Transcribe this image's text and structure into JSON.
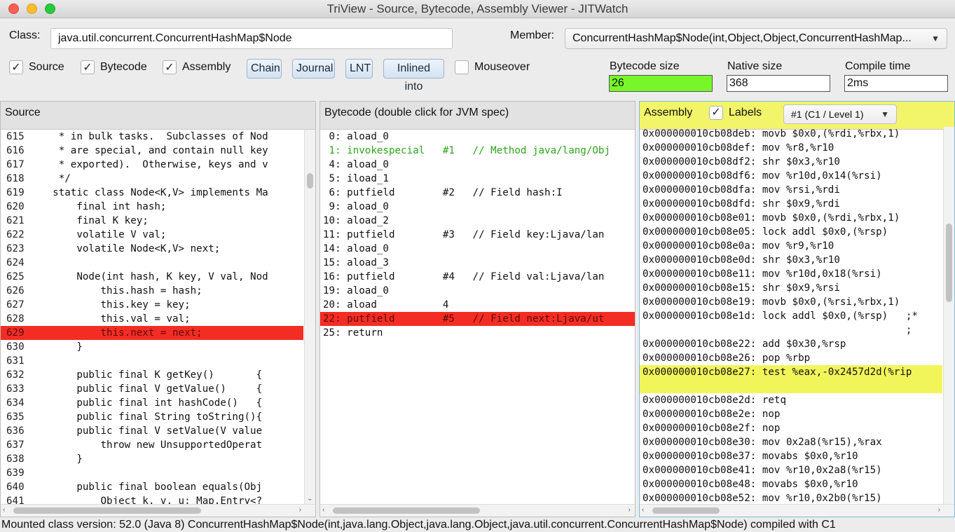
{
  "window": {
    "title": "TriView - Source, Bytecode, Assembly Viewer - JITWatch"
  },
  "toolbar": {
    "class_label": "Class:",
    "class_value": "java.util.concurrent.ConcurrentHashMap$Node",
    "member_label": "Member:",
    "member_value": "ConcurrentHashMap$Node(int,Object,Object,ConcurrentHashMap...",
    "checkboxes": {
      "source": "Source",
      "bytecode": "Bytecode",
      "assembly": "Assembly",
      "mouseover": "Mouseover"
    },
    "buttons": {
      "chain": "Chain",
      "journal": "Journal",
      "lnt": "LNT",
      "inlined": "Inlined into"
    },
    "metrics": {
      "bytecode_size_label": "Bytecode size",
      "bytecode_size": "26",
      "native_size_label": "Native size",
      "native_size": "368",
      "compile_time_label": "Compile time",
      "compile_time": "2ms"
    },
    "colors": {
      "bytecode_size_bg": "#77f72a"
    }
  },
  "source": {
    "header": "Source",
    "lines": [
      {
        "n": "615",
        "t": "     * in bulk tasks.  Subclasses of Nod"
      },
      {
        "n": "616",
        "t": "     * are special, and contain null key"
      },
      {
        "n": "617",
        "t": "     * exported).  Otherwise, keys and v"
      },
      {
        "n": "618",
        "t": "     */"
      },
      {
        "n": "619",
        "t": "    static class Node<K,V> implements Ma"
      },
      {
        "n": "620",
        "t": "        final int hash;"
      },
      {
        "n": "621",
        "t": "        final K key;"
      },
      {
        "n": "622",
        "t": "        volatile V val;"
      },
      {
        "n": "623",
        "t": "        volatile Node<K,V> next;"
      },
      {
        "n": "624",
        "t": ""
      },
      {
        "n": "625",
        "t": "        Node(int hash, K key, V val, Nod"
      },
      {
        "n": "626",
        "t": "            this.hash = hash;"
      },
      {
        "n": "627",
        "t": "            this.key = key;"
      },
      {
        "n": "628",
        "t": "            this.val = val;"
      },
      {
        "n": "629",
        "t": "            this.next = next;",
        "hl": "red"
      },
      {
        "n": "630",
        "t": "        }"
      },
      {
        "n": "631",
        "t": ""
      },
      {
        "n": "632",
        "t": "        public final K getKey()       {"
      },
      {
        "n": "633",
        "t": "        public final V getValue()     {"
      },
      {
        "n": "634",
        "t": "        public final int hashCode()   {"
      },
      {
        "n": "635",
        "t": "        public final String toString(){"
      },
      {
        "n": "636",
        "t": "        public final V setValue(V value"
      },
      {
        "n": "637",
        "t": "            throw new UnsupportedOperat"
      },
      {
        "n": "638",
        "t": "        }"
      },
      {
        "n": "639",
        "t": ""
      },
      {
        "n": "640",
        "t": "        public final boolean equals(Obj"
      },
      {
        "n": "641",
        "t": "            Object k, v, u; Map.Entry<?"
      }
    ]
  },
  "bytecode": {
    "header": "Bytecode (double click for JVM spec)",
    "lines": [
      {
        "t": " 0: aload_0"
      },
      {
        "t": " 1: invokespecial   #1   // Method java/lang/Obj",
        "hl": "green"
      },
      {
        "t": " 4: aload_0"
      },
      {
        "t": " 5: iload_1"
      },
      {
        "t": " 6: putfield        #2   // Field hash:I"
      },
      {
        "t": " 9: aload_0"
      },
      {
        "t": "10: aload_2"
      },
      {
        "t": "11: putfield        #3   // Field key:Ljava/lan"
      },
      {
        "t": "14: aload_0"
      },
      {
        "t": "15: aload_3"
      },
      {
        "t": "16: putfield        #4   // Field val:Ljava/lan"
      },
      {
        "t": "19: aload_0"
      },
      {
        "t": "20: aload           4"
      },
      {
        "t": "22: putfield        #5   // Field next:Ljava/ut",
        "hl": "red"
      },
      {
        "t": "25: return"
      }
    ]
  },
  "assembly": {
    "header": "Assembly",
    "labels_checkbox": "Labels",
    "compilation_select": "#1  (C1 / Level 1)",
    "lines": [
      {
        "t": "0x000000010cb08deb: movb $0x0,(%rdi,%rbx,1)"
      },
      {
        "t": "0x000000010cb08def: mov %r8,%r10"
      },
      {
        "t": "0x000000010cb08df2: shr $0x3,%r10"
      },
      {
        "t": "0x000000010cb08df6: mov %r10d,0x14(%rsi)"
      },
      {
        "t": "0x000000010cb08dfa: mov %rsi,%rdi"
      },
      {
        "t": "0x000000010cb08dfd: shr $0x9,%rdi"
      },
      {
        "t": "0x000000010cb08e01: movb $0x0,(%rdi,%rbx,1)"
      },
      {
        "t": "0x000000010cb08e05: lock addl $0x0,(%rsp)"
      },
      {
        "t": "0x000000010cb08e0a: mov %r9,%r10"
      },
      {
        "t": "0x000000010cb08e0d: shr $0x3,%r10"
      },
      {
        "t": "0x000000010cb08e11: mov %r10d,0x18(%rsi)"
      },
      {
        "t": "0x000000010cb08e15: shr $0x9,%rsi"
      },
      {
        "t": "0x000000010cb08e19: movb $0x0,(%rsi,%rbx,1)"
      },
      {
        "t": "0x000000010cb08e1d: lock addl $0x0,(%rsp)   ;*"
      },
      {
        "t": "                                            ;"
      },
      {
        "t": "0x000000010cb08e22: add $0x30,%rsp"
      },
      {
        "t": "0x000000010cb08e26: pop %rbp"
      },
      {
        "t": "0x000000010cb08e27: test %eax,-0x2457d2d(%rip",
        "hl": "yellow"
      },
      {
        "t": "0x000000010cb08e2d: retq"
      },
      {
        "t": "0x000000010cb08e2e: nop"
      },
      {
        "t": "0x000000010cb08e2f: nop"
      },
      {
        "t": "0x000000010cb08e30: mov 0x2a8(%r15),%rax"
      },
      {
        "t": "0x000000010cb08e37: movabs $0x0,%r10"
      },
      {
        "t": "0x000000010cb08e41: mov %r10,0x2a8(%r15)"
      },
      {
        "t": "0x000000010cb08e48: movabs $0x0,%r10"
      },
      {
        "t": "0x000000010cb08e52: mov %r10,0x2b0(%r15)"
      }
    ]
  },
  "status": "Mounted class version: 52.0 (Java 8) ConcurrentHashMap$Node(int,java.lang.Object,java.lang.Object,java.util.concurrent.ConcurrentHashMap$Node) compiled with C1"
}
